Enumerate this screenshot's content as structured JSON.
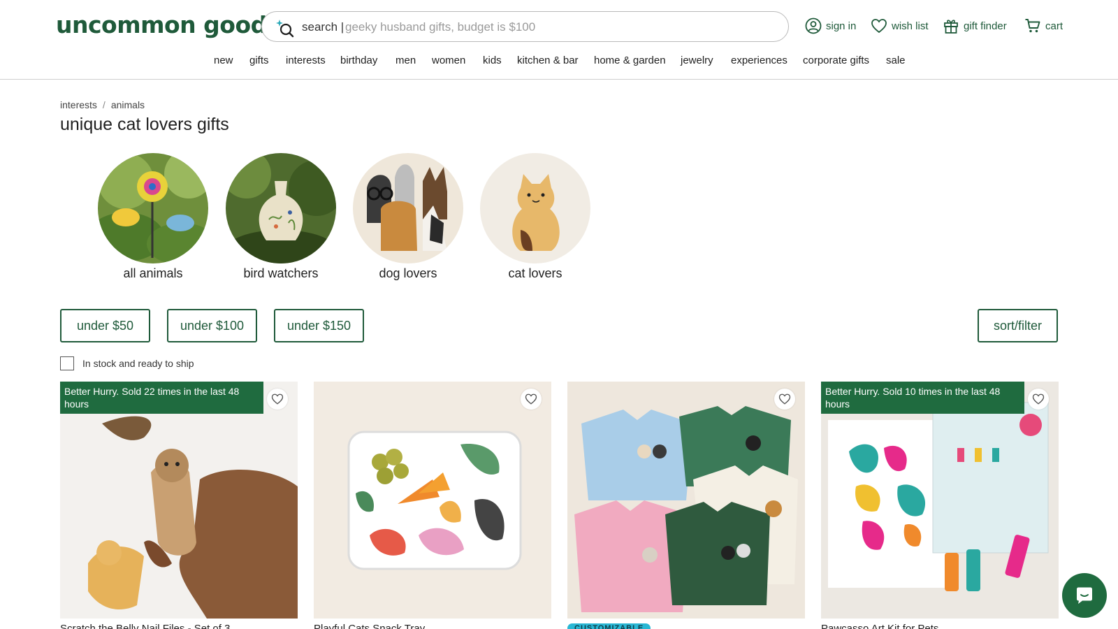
{
  "header": {
    "logo": "uncommon goods",
    "search_label": "search |",
    "search_placeholder": "geeky husband gifts, budget is $100",
    "links": {
      "sign_in": "sign in",
      "wish_list": "wish list",
      "gift_finder": "gift finder",
      "cart": "cart"
    }
  },
  "nav": [
    "new",
    "gifts",
    "interests",
    "birthday",
    "men",
    "women",
    "kids",
    "kitchen & bar",
    "home & garden",
    "jewelry",
    "experiences",
    "corporate gifts",
    "sale"
  ],
  "breadcrumb": {
    "first": "interests",
    "separator": "/",
    "second": "animals"
  },
  "page_title": "unique cat lovers gifts",
  "categories": [
    "all animals",
    "bird watchers",
    "dog lovers",
    "cat lovers"
  ],
  "price_filters": [
    "under $50",
    "under $100",
    "under $150"
  ],
  "sort_filter": "sort/filter",
  "in_stock_label": "In stock and ready to ship",
  "products": [
    {
      "badge": "Better Hurry. Sold 22 times in the last 48 hours",
      "name": "Scratch the Belly Nail Files - Set of 3"
    },
    {
      "badge": "",
      "name": "Playful Cats Snack Tray"
    },
    {
      "badge": "",
      "tag": "CUSTOMIZABLE",
      "name": ""
    },
    {
      "badge": "Better Hurry. Sold 10 times in the last 48 hours",
      "name": "Pawcasso Art Kit for Pets"
    }
  ],
  "colors": {
    "brand_green": "#1f5a3a",
    "badge_green": "#1f6b3f",
    "tag_blue": "#2ab7d4"
  }
}
